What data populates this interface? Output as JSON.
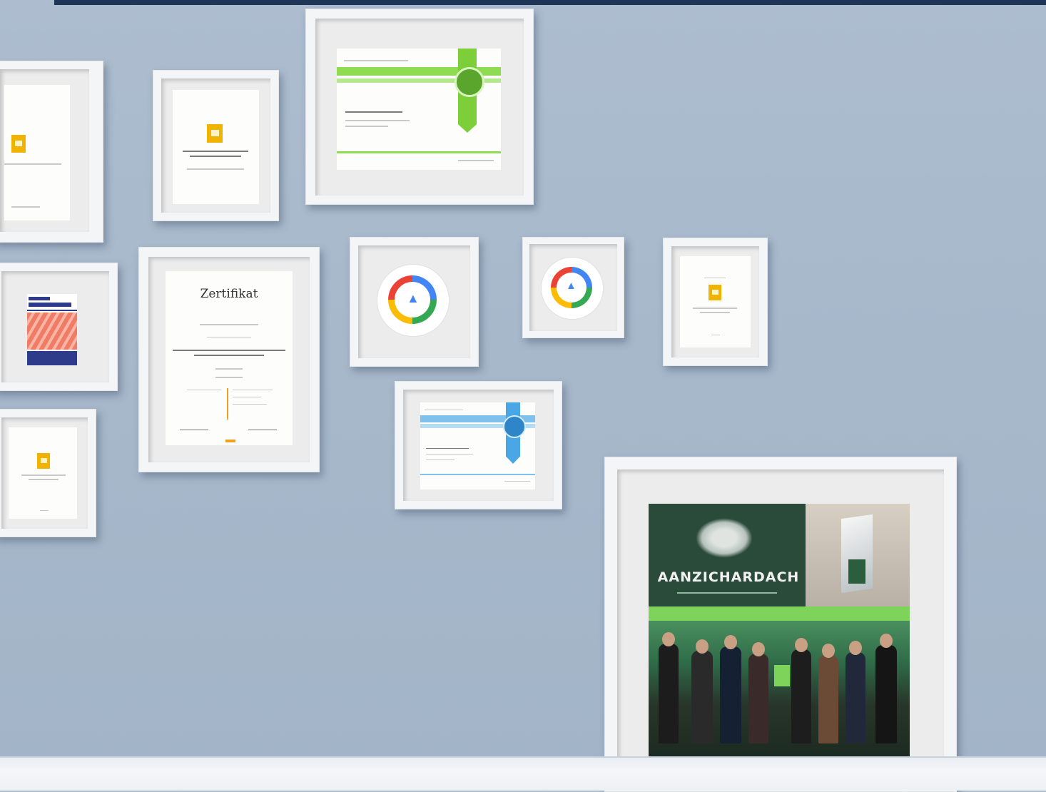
{
  "scene": {
    "wall_color": "#a7b8cb",
    "topbar_color": "#1f3557",
    "floor_color": "#f1f4f6"
  },
  "certificates": {
    "zertifikat_heading": "Zertifikat",
    "event_sign": "AANZICHARDACH"
  },
  "badges": {
    "google_ads_icon": "google-ads-icon"
  },
  "colors": {
    "green_ribbon": "#7dcf3a",
    "blue_ribbon": "#4aa7e6",
    "yellow_icon": "#f0b400",
    "frame_white": "#f4f5f6"
  }
}
